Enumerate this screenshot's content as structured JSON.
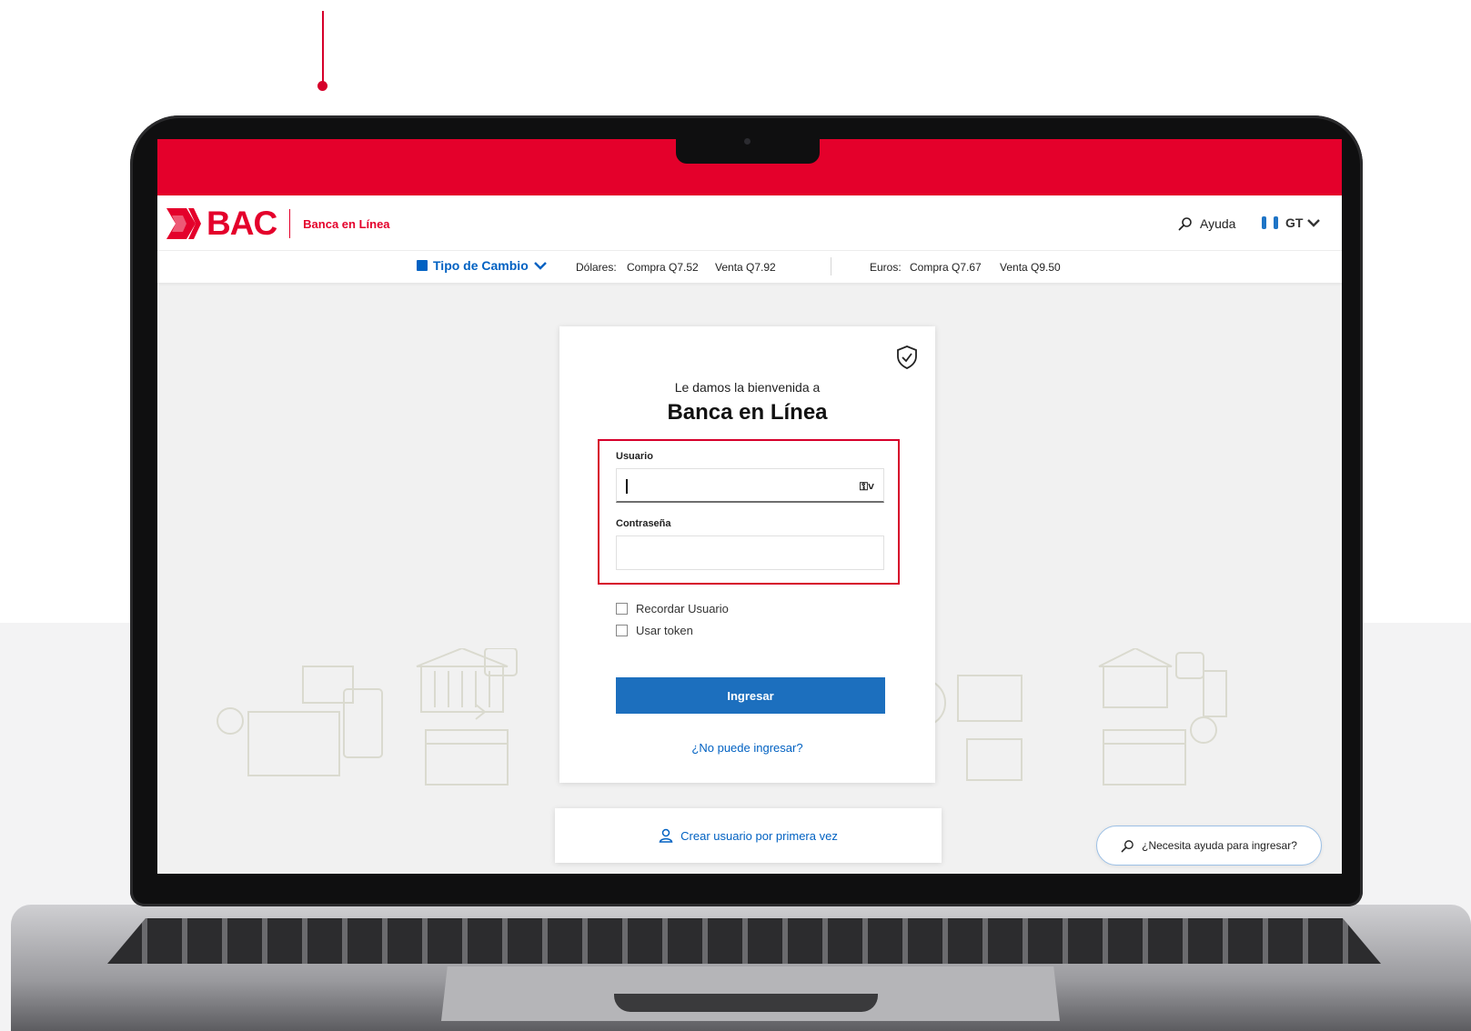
{
  "header": {
    "brand": "BAC",
    "product": "Banca en Línea",
    "help_label": "Ayuda",
    "country_code": "GT"
  },
  "rates": {
    "toggle_label": "Tipo de Cambio",
    "dollars": {
      "label": "Dólares:",
      "buy": "Compra Q7.52",
      "sell": "Venta Q7.92"
    },
    "euros": {
      "label": "Euros:",
      "buy": "Compra Q7.67",
      "sell": "Venta Q9.50"
    }
  },
  "login": {
    "welcome": "Le damos la bienvenida a",
    "title": "Banca en Línea",
    "user_label": "Usuario",
    "user_value": "",
    "password_label": "Contraseña",
    "password_value": "",
    "remember_label": "Recordar Usuario",
    "token_label": "Usar token",
    "submit_label": "Ingresar",
    "cant_login": "¿No puede ingresar?"
  },
  "create_user": "Crear usuario por primera vez",
  "help_pill": "¿Necesita ayuda para ingresar?",
  "colors": {
    "brand_red": "#e4002b",
    "primary_blue": "#1c6fbe",
    "link_blue": "#0061c2",
    "highlight": "#d6002a"
  },
  "icons": [
    "shield-check-icon",
    "search-icon",
    "key-icon",
    "user-icon",
    "calculator-icon",
    "chevron-down-icon"
  ]
}
